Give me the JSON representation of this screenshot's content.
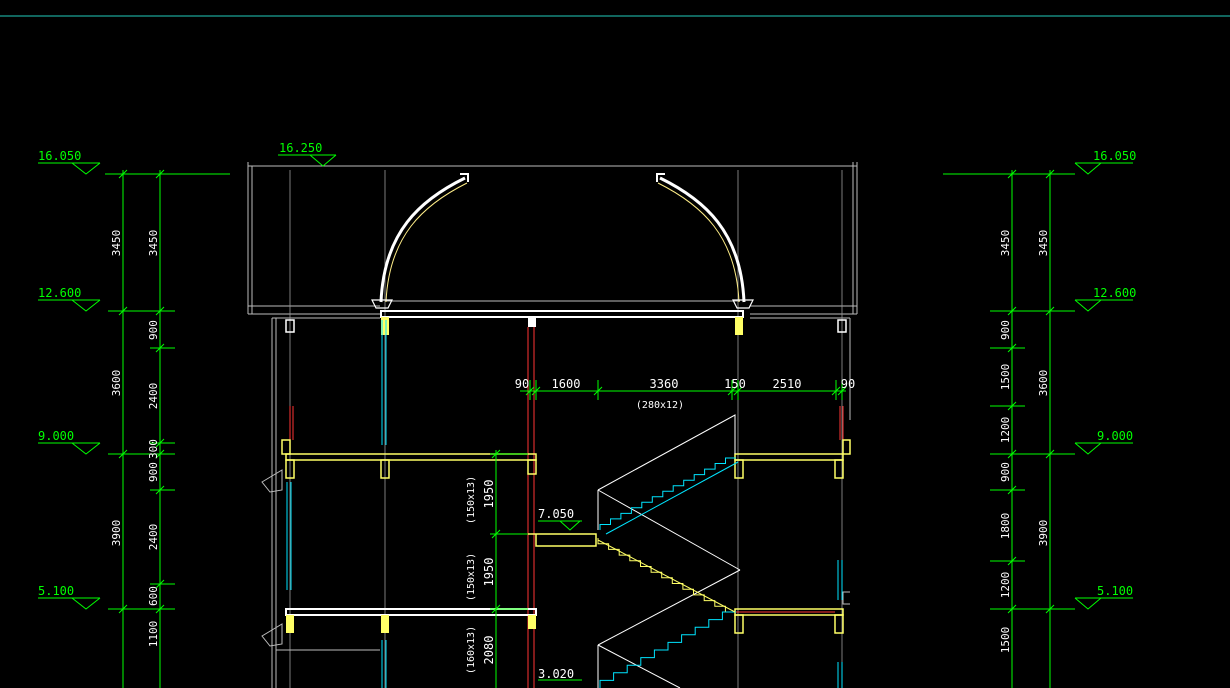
{
  "elevations": {
    "left": [
      "16.050",
      "12.600",
      "9.000",
      "5.100"
    ],
    "right": [
      "16.050",
      "12.600",
      "9.000",
      "5.100"
    ],
    "roof_top": "16.250",
    "landing_upper": "7.050",
    "landing_lower": "3.020"
  },
  "dims": {
    "left_outer": [
      "3450",
      "3600",
      "3900"
    ],
    "left_inner": [
      "3450",
      "900",
      "2400",
      "300",
      "900",
      "2400",
      "600",
      "1100"
    ],
    "right_inner": [
      "3450",
      "900",
      "1500",
      "1200",
      "900",
      "1800",
      "1200",
      "1500"
    ],
    "right_outer": [
      "3450",
      "3600",
      "3900"
    ],
    "horizontal": [
      "90",
      "1600",
      "3360",
      "150",
      "2510",
      "90"
    ],
    "tread_note": "(280x12)",
    "flights": [
      {
        "length": "1950",
        "note": "(150x13)"
      },
      {
        "length": "1950",
        "note": "(150x13)"
      },
      {
        "length": "2080",
        "note": "(160x13)"
      }
    ]
  },
  "colors": {
    "background": "#000000",
    "dimension": "#00ff00",
    "wall": "#ffff66",
    "outline": "#ffffff",
    "glazing": "#00e5ff",
    "column": "#ff3333",
    "grid": "#9a9a9a"
  }
}
